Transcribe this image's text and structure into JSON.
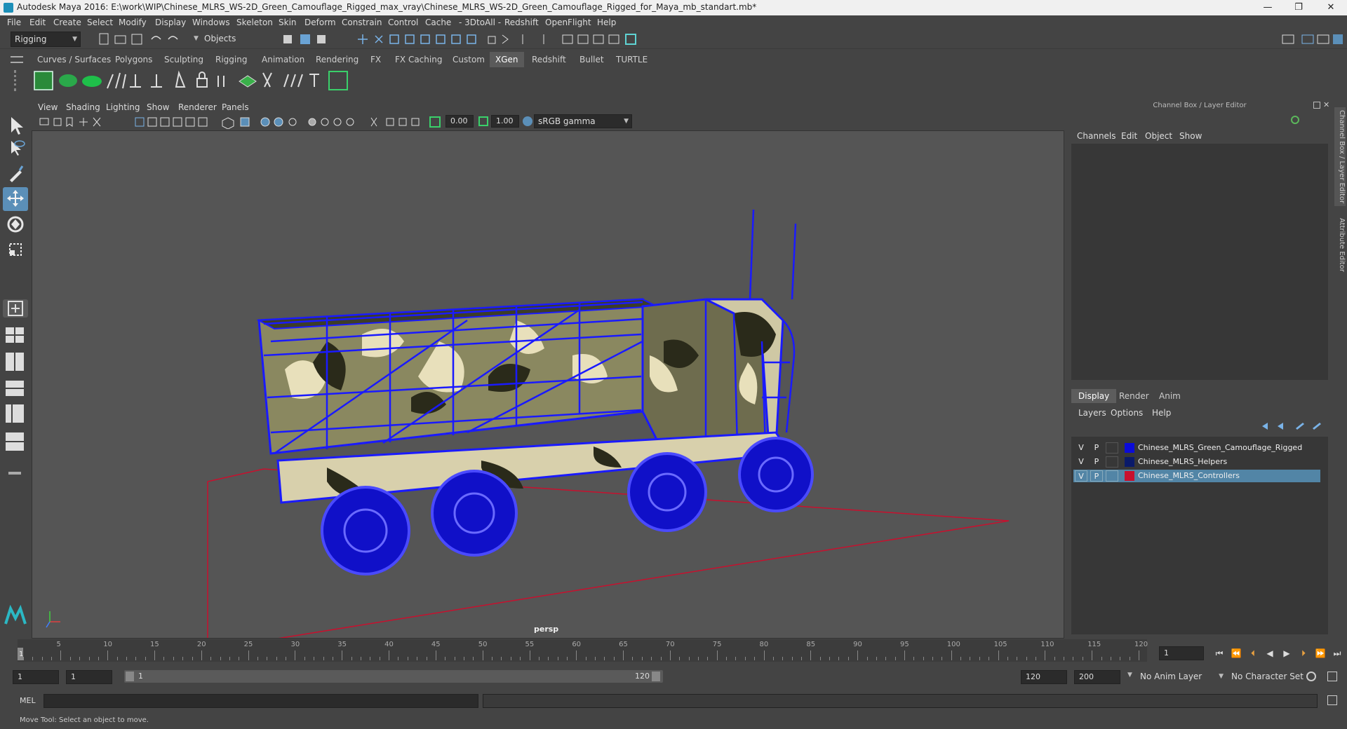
{
  "window": {
    "title": "Autodesk Maya 2016: E:\\work\\WIP\\Chinese_MLRS_WS-2D_Green_Camouflage_Rigged_max_vray\\Chinese_MLRS_WS-2D_Green_Camouflage_Rigged_for_Maya_mb_standart.mb*",
    "minimize": "—",
    "restore": "❐",
    "close": "✕"
  },
  "menubar": [
    "File",
    "Edit",
    "Create",
    "Select",
    "Modify",
    "Display",
    "Windows",
    "Skeleton",
    "Skin",
    "Deform",
    "Constrain",
    "Control",
    "Cache",
    "- 3DtoAll -",
    "Redshift",
    "OpenFlight",
    "Help"
  ],
  "statusline": {
    "menuset": "Rigging",
    "selection_mode": "Objects"
  },
  "shelf_tabs": [
    "Curves / Surfaces",
    "Polygons",
    "Sculpting",
    "Rigging",
    "Animation",
    "Rendering",
    "FX",
    "FX Caching",
    "Custom",
    "XGen",
    "Redshift",
    "Bullet",
    "TURTLE"
  ],
  "shelf_active": "XGen",
  "viewport": {
    "menu": [
      "View",
      "Shading",
      "Lighting",
      "Show",
      "Renderer",
      "Panels"
    ],
    "exposure": "0.00",
    "gamma": "1.00",
    "colorspace": "sRGB gamma",
    "camera": "persp"
  },
  "right_panel": {
    "header": "Channel Box / Layer Editor",
    "channel_menu": [
      "Channels",
      "Edit",
      "Object",
      "Show"
    ],
    "layer_tabs": [
      "Display",
      "Render",
      "Anim"
    ],
    "layer_active": "Display",
    "layer_menu": [
      "Layers",
      "Options",
      "Help"
    ],
    "layers": [
      {
        "v": "V",
        "p": "P",
        "color": "#0b0bd8",
        "name": "Chinese_MLRS_Green_Camouflage_Rigged",
        "selected": false
      },
      {
        "v": "V",
        "p": "P",
        "color": "#0a1a6a",
        "name": "Chinese_MLRS_Helpers",
        "selected": false
      },
      {
        "v": "V",
        "p": "P",
        "color": "#c8102e",
        "name": "Chinese_MLRS_Controllers",
        "selected": true
      }
    ]
  },
  "side_tabs": [
    "Channel Box / Layer Editor",
    "Attribute Editor"
  ],
  "timeline": {
    "ticks": [
      "5",
      "10",
      "15",
      "20",
      "25",
      "30",
      "35",
      "40",
      "45",
      "50",
      "55",
      "60",
      "65",
      "70",
      "75",
      "80",
      "85",
      "90",
      "95",
      "100",
      "105",
      "110",
      "115",
      "120"
    ],
    "start_marker": "1",
    "current_frame": "1"
  },
  "range": {
    "start": "1",
    "playback_start": "1",
    "slider_start": "1",
    "slider_end": "120",
    "playback_end": "120",
    "end": "200",
    "anim_layer": "No Anim Layer",
    "character_set": "No Character Set"
  },
  "command": {
    "label": "MEL"
  },
  "help": "Move Tool: Select an object to move."
}
